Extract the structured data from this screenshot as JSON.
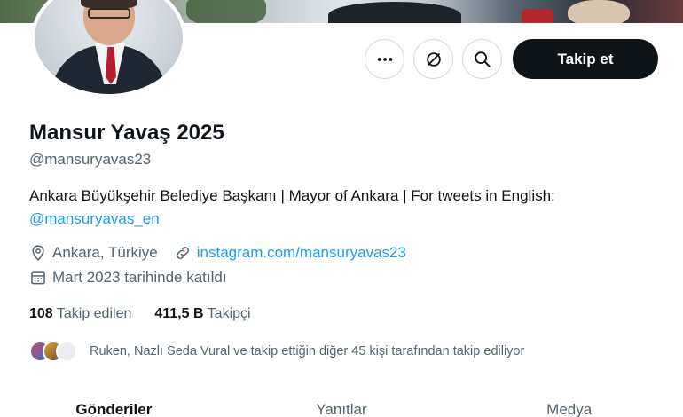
{
  "profile": {
    "name": "Mansur Yavaş 2025",
    "handle": "@mansuryavas23",
    "bio_text": "Ankara Büyükşehir Belediye Başkanı | Mayor of Ankara | For tweets in English:",
    "bio_mention": "@mansuryavas_en",
    "location": "Ankara, Türkiye",
    "website": "instagram.com/mansuryavas23",
    "joined": "Mart 2023 tarihinde katıldı"
  },
  "actions": {
    "more_icon": "more-icon",
    "grok_icon": "grok-icon",
    "search_icon": "search-icon",
    "follow_label": "Takip et"
  },
  "counts": {
    "following_value": "108",
    "following_label": "Takip edilen",
    "followers_value": "411,5 B",
    "followers_label": "Takipçi"
  },
  "followed_by": "Ruken, Nazlı Seda Vural ve takip ettiğin diğer 45 kişi tarafından takip ediliyor",
  "tabs": [
    {
      "label": "Gönderiler",
      "active": true
    },
    {
      "label": "Yanıtlar",
      "active": false
    },
    {
      "label": "Medya",
      "active": false
    }
  ],
  "colors": {
    "accent": "#1d9bf0",
    "text": "#0f1419",
    "secondary": "#536471"
  }
}
